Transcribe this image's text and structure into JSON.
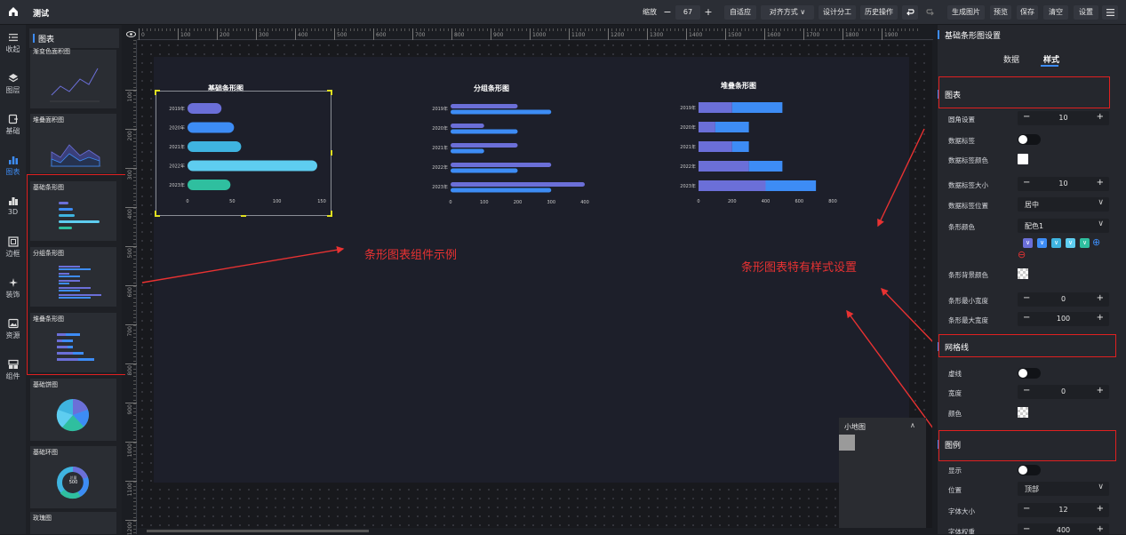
{
  "app": {
    "title": "测试",
    "home_icon": "home-icon"
  },
  "toolbar": {
    "zoom_label": "缩放",
    "zoom_minus": "−",
    "zoom_value": "67",
    "zoom_plus": "+",
    "fit": "自适应",
    "align": "对齐方式",
    "align_caret": "∨",
    "design_split": "设计分工",
    "history": "历史操作",
    "undo_icon": "undo-icon",
    "redo_icon": "redo-icon",
    "gen_image": "生成图片",
    "preview": "预览",
    "save": "保存",
    "clear": "清空",
    "settings": "设置",
    "menu_icon": "menu-icon"
  },
  "leftbar": {
    "items": [
      {
        "label": "收起",
        "icon": "collapse-icon"
      },
      {
        "label": "图层",
        "icon": "layers-icon"
      },
      {
        "label": "基础",
        "icon": "basic-icon"
      },
      {
        "label": "图表",
        "icon": "chart-icon"
      },
      {
        "label": "3D",
        "icon": "3d-icon"
      },
      {
        "label": "边框",
        "icon": "border-icon"
      },
      {
        "label": "装饰",
        "icon": "decoration-icon"
      },
      {
        "label": "资源",
        "icon": "resource-icon"
      },
      {
        "label": "组件",
        "icon": "component-icon"
      }
    ]
  },
  "components": {
    "header": "图表",
    "cards": [
      {
        "name": "渐变色面积图"
      },
      {
        "name": "堆叠面积图"
      },
      {
        "name": "基础条形图"
      },
      {
        "name": "分组条形图"
      },
      {
        "name": "堆叠条形图"
      },
      {
        "name": "基础饼图"
      },
      {
        "name": "基础环图"
      },
      {
        "name": "玫瑰图"
      }
    ],
    "ring_center_top": "总量",
    "ring_center_value": "500"
  },
  "ruler": {
    "top_ticks": [
      "0",
      "100",
      "200",
      "300",
      "400",
      "500",
      "600",
      "700",
      "800",
      "900",
      "1000",
      "1100",
      "1200",
      "1300",
      "1400",
      "1500",
      "1600",
      "1700",
      "1800",
      "1900"
    ],
    "left_ticks": [
      "100",
      "200",
      "300",
      "400",
      "500",
      "600",
      "700",
      "800",
      "900",
      "1000",
      "1100",
      "1200"
    ],
    "eye_icon": "eye-icon"
  },
  "colors": {
    "accent": "#3d8cf5",
    "annotation": "#e83232",
    "purple": "#6b6fd8",
    "blue": "#3d8cf5",
    "cyan": "#3fb4e0",
    "light_cyan": "#5ecdf0",
    "teal": "#2fbf9f"
  },
  "chart_data": [
    {
      "type": "bar",
      "orientation": "horizontal",
      "title": "基础条形图",
      "categories": [
        "2019年",
        "2020年",
        "2021年",
        "2022年",
        "2023年"
      ],
      "values": [
        38,
        52,
        60,
        145,
        48
      ],
      "xlim": [
        0,
        150
      ],
      "xticks": [
        "0",
        "50",
        "100",
        "150"
      ]
    },
    {
      "type": "bar",
      "orientation": "horizontal",
      "title": "分组条形图",
      "categories": [
        "2019年",
        "2020年",
        "2021年",
        "2022年",
        "2023年"
      ],
      "series": [
        {
          "values": [
            200,
            100,
            200,
            300,
            400
          ]
        },
        {
          "values": [
            300,
            200,
            100,
            200,
            300
          ]
        }
      ],
      "xlim": [
        0,
        400
      ],
      "xticks": [
        "0",
        "100",
        "200",
        "300",
        "400"
      ]
    },
    {
      "type": "bar",
      "orientation": "horizontal",
      "stacked": true,
      "title": "堆叠条形图",
      "categories": [
        "2019年",
        "2020年",
        "2021年",
        "2022年",
        "2023年"
      ],
      "series": [
        {
          "values": [
            200,
            100,
            200,
            300,
            400
          ]
        },
        {
          "values": [
            300,
            200,
            100,
            200,
            300
          ]
        }
      ],
      "xlim": [
        0,
        800
      ],
      "xticks": [
        "0",
        "200",
        "400",
        "600",
        "800"
      ]
    }
  ],
  "annotations": {
    "left": "条形图表组件示例",
    "right": "条形图表特有样式设置"
  },
  "minimap": {
    "title": "小地图",
    "caret": "∧"
  },
  "props": {
    "title": "基础条形图设置",
    "tabs": [
      "数据",
      "样式"
    ],
    "sections": {
      "chart": "图表",
      "grid": "网格线",
      "legend": "图例"
    },
    "rows": {
      "radius": {
        "label": "圆角设置",
        "value": "10"
      },
      "data_label": {
        "label": "数据标签"
      },
      "data_label_color": {
        "label": "数据标签颜色"
      },
      "data_label_size": {
        "label": "数据标签大小",
        "value": "10"
      },
      "data_label_pos": {
        "label": "数据标签位置",
        "value": "居中"
      },
      "bar_color": {
        "label": "条形颜色",
        "value": "配色1"
      },
      "bar_bg_color": {
        "label": "条形背景颜色"
      },
      "bar_min_width": {
        "label": "条形最小宽度",
        "value": "0"
      },
      "bar_max_width": {
        "label": "条形最大宽度",
        "value": "100"
      },
      "dashed": {
        "label": "虚线"
      },
      "grid_width": {
        "label": "宽度",
        "value": "0"
      },
      "grid_color": {
        "label": "颜色"
      },
      "legend_show": {
        "label": "显示"
      },
      "legend_pos": {
        "label": "位置",
        "value": "顶部"
      },
      "legend_font_size": {
        "label": "字体大小",
        "value": "12"
      },
      "legend_font_weight": {
        "label": "字体权重",
        "value": "400"
      }
    },
    "minus": "−",
    "plus": "+",
    "caret": "∨",
    "remove_icon": "⊖",
    "add_icon": "⊕",
    "chip_caret": "∨"
  }
}
